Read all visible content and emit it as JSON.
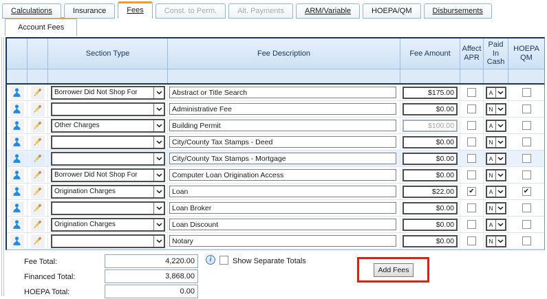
{
  "tabs": [
    {
      "label": "Calculations",
      "underlined": true,
      "state": "normal"
    },
    {
      "label": "Insurance",
      "underlined": false,
      "state": "normal"
    },
    {
      "label": "Fees",
      "underlined": true,
      "state": "active"
    },
    {
      "label": "Const. to Perm.",
      "underlined": false,
      "state": "disabled"
    },
    {
      "label": "Alt. Payments",
      "underlined": false,
      "state": "disabled"
    },
    {
      "label": "ARM/Variable",
      "underlined": true,
      "state": "normal"
    },
    {
      "label": "HOEPA/QM",
      "underlined": false,
      "state": "normal"
    },
    {
      "label": "Disbursements",
      "underlined": true,
      "state": "normal"
    }
  ],
  "subtab": {
    "label": "Account Fees"
  },
  "table": {
    "headers": {
      "section_type": "Section Type",
      "fee_description": "Fee Description",
      "fee_amount": "Fee Amount",
      "affect_apr": "Affect\nAPR",
      "paid_in_cash": "Paid\nIn\nCash",
      "hoepa_qm": "HOEPA\nQM"
    },
    "rows": [
      {
        "section_type": "Borrower Did Not Shop For",
        "fee_description": "Abstract or Title Search",
        "fee_amount": "$175.00",
        "affect_apr": false,
        "paid_in_cash": "A",
        "hoepa_qm": false,
        "amount_disabled": false,
        "selected": false
      },
      {
        "section_type": "",
        "fee_description": "Administrative Fee",
        "fee_amount": "$0.00",
        "affect_apr": false,
        "paid_in_cash": "N",
        "hoepa_qm": false,
        "amount_disabled": false,
        "selected": false
      },
      {
        "section_type": "Other Charges",
        "fee_description": "Building Permit",
        "fee_amount": "$100.00",
        "affect_apr": false,
        "paid_in_cash": "A",
        "hoepa_qm": false,
        "amount_disabled": true,
        "selected": false
      },
      {
        "section_type": "",
        "fee_description": "City/County Tax Stamps - Deed",
        "fee_amount": "$0.00",
        "affect_apr": false,
        "paid_in_cash": "N",
        "hoepa_qm": false,
        "amount_disabled": false,
        "selected": false
      },
      {
        "section_type": "",
        "fee_description": "City/County Tax Stamps - Mortgage",
        "fee_amount": "$0.00",
        "affect_apr": false,
        "paid_in_cash": "A",
        "hoepa_qm": false,
        "amount_disabled": false,
        "selected": true
      },
      {
        "section_type": "Borrower Did Not Shop For",
        "fee_description": "Computer Loan Origination Access",
        "fee_amount": "$0.00",
        "affect_apr": false,
        "paid_in_cash": "N",
        "hoepa_qm": false,
        "amount_disabled": false,
        "selected": false
      },
      {
        "section_type": "Origination Charges",
        "fee_description": "Loan",
        "fee_amount": "$22.00",
        "affect_apr": true,
        "paid_in_cash": "A",
        "hoepa_qm": true,
        "amount_disabled": false,
        "selected": false
      },
      {
        "section_type": "",
        "fee_description": "Loan Broker",
        "fee_amount": "$0.00",
        "affect_apr": false,
        "paid_in_cash": "N",
        "hoepa_qm": false,
        "amount_disabled": false,
        "selected": false
      },
      {
        "section_type": "Origination Charges",
        "fee_description": "Loan Discount",
        "fee_amount": "$0.00",
        "affect_apr": false,
        "paid_in_cash": "A",
        "hoepa_qm": false,
        "amount_disabled": false,
        "selected": false
      },
      {
        "section_type": "",
        "fee_description": "Notary",
        "fee_amount": "$0.00",
        "affect_apr": false,
        "paid_in_cash": "N",
        "hoepa_qm": false,
        "amount_disabled": false,
        "selected": false
      }
    ]
  },
  "totals": {
    "fee_total_label": "Fee Total:",
    "fee_total": "4,220.00",
    "financed_total_label": "Financed Total:",
    "financed_total": "3,868.00",
    "hoepa_total_label": "HOEPA Total:",
    "hoepa_total": "0.00",
    "show_separate_label": "Show Separate Totals",
    "show_separate_checked": false,
    "info_glyph": "i"
  },
  "actions": {
    "add_fees_label": "Add Fees"
  },
  "colors": {
    "accent_orange": "#F59A23",
    "header_text": "#17365D",
    "table_border_blue": "#6A94C4",
    "person_icon_blue": "#1B8CEA",
    "annotation_red": "#EA1C0D",
    "selected_row": "#E9F2FC"
  }
}
